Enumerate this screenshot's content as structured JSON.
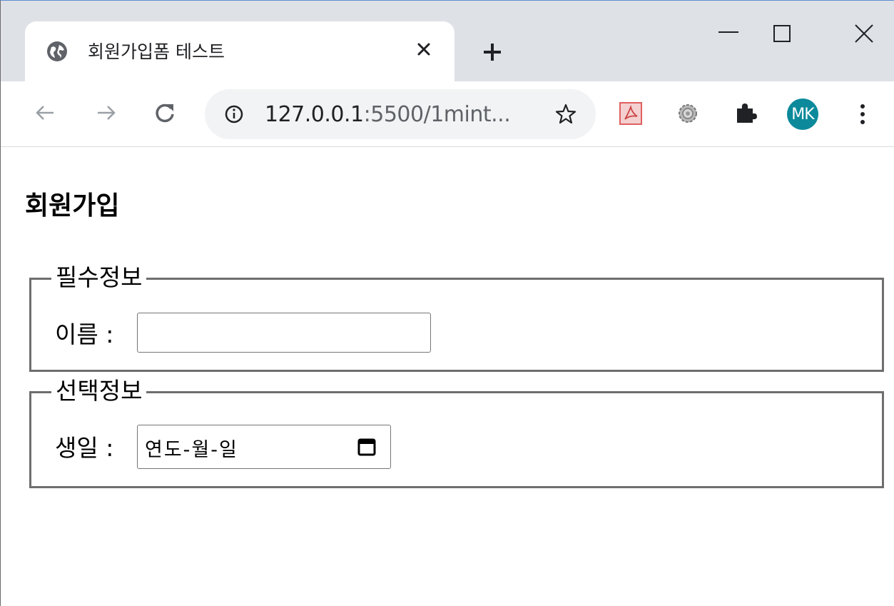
{
  "browser": {
    "tab": {
      "title": "회원가입폼 테스트",
      "favicon": "globe-icon"
    },
    "new_tab_icon": "plus-icon",
    "window_controls": [
      "minimize-icon",
      "maximize-icon",
      "close-icon"
    ],
    "toolbar": {
      "url_host": "127.0.0.1",
      "url_rest": ":5500/1mint...",
      "extensions": [
        "pdf-icon",
        "gear-icon",
        "puzzle-icon"
      ],
      "avatar_initials": "MK",
      "avatar_color": "#0c8a9b"
    }
  },
  "page": {
    "title": "회원가입",
    "required_section": {
      "legend": "필수정보",
      "name_label": "이름 :",
      "name_value": ""
    },
    "optional_section": {
      "legend": "선택정보",
      "birthday_label": "생일 :",
      "birthday_placeholder": "연도-월-일"
    }
  }
}
